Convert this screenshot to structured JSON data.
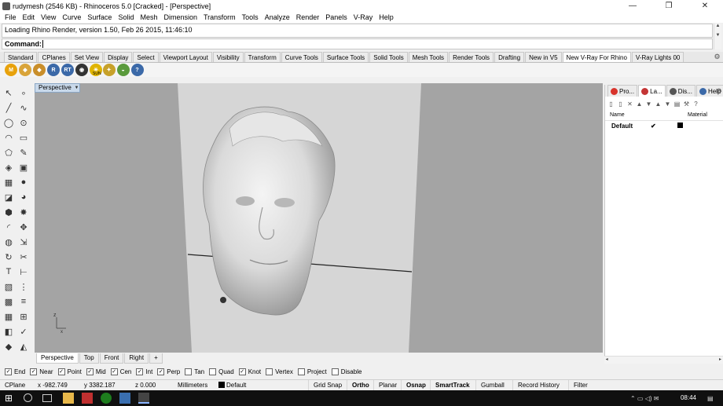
{
  "window": {
    "title": "rudymesh (2546 KB) - Rhinoceros 5.0 [Cracked] - [Perspective]"
  },
  "menu": [
    "File",
    "Edit",
    "View",
    "Curve",
    "Surface",
    "Solid",
    "Mesh",
    "Dimension",
    "Transform",
    "Tools",
    "Analyze",
    "Render",
    "Panels",
    "V-Ray",
    "Help"
  ],
  "command": {
    "history": "Loading Rhino Render, version 1.50, Feb 26 2015, 11:46:10",
    "prompt_label": "Command:",
    "value": ""
  },
  "toolbar_tabs": [
    {
      "label": "Standard",
      "active": false
    },
    {
      "label": "CPlanes",
      "active": false
    },
    {
      "label": "Set View",
      "active": false
    },
    {
      "label": "Display",
      "active": false
    },
    {
      "label": "Select",
      "active": false
    },
    {
      "label": "Viewport Layout",
      "active": false
    },
    {
      "label": "Visibility",
      "active": false
    },
    {
      "label": "Transform",
      "active": false
    },
    {
      "label": "Curve Tools",
      "active": false
    },
    {
      "label": "Surface Tools",
      "active": false
    },
    {
      "label": "Solid Tools",
      "active": false
    },
    {
      "label": "Mesh Tools",
      "active": false
    },
    {
      "label": "Render Tools",
      "active": false
    },
    {
      "label": "Drafting",
      "active": false
    },
    {
      "label": "New in V5",
      "active": false
    },
    {
      "label": "New V-Ray For Rhino",
      "active": true
    },
    {
      "label": "V-Ray Lights 00",
      "active": false
    }
  ],
  "toolbar_icons": [
    {
      "name": "vray-m-icon",
      "glyph": "M",
      "color": "#e8a20c"
    },
    {
      "name": "vray-material-icon",
      "glyph": "◆",
      "color": "#d9a43a"
    },
    {
      "name": "vray-options-icon",
      "glyph": "◆",
      "color": "#c98e2a"
    },
    {
      "name": "vray-r-icon",
      "glyph": "R",
      "color": "#3b69a8"
    },
    {
      "name": "vray-rt-icon",
      "glyph": "RT",
      "color": "#3b69a8"
    },
    {
      "name": "vray-camera-icon",
      "glyph": "◉",
      "color": "#333333"
    },
    {
      "name": "vray-sun-icon",
      "glyph": "☀",
      "color": "#e0b400"
    },
    {
      "name": "vray-light-icon",
      "glyph": "✦",
      "color": "#c7a12a"
    },
    {
      "name": "vray-dome-icon",
      "glyph": "◒",
      "color": "#5a9a3c"
    },
    {
      "name": "vray-help-icon",
      "glyph": "?",
      "color": "#3b69a8"
    }
  ],
  "sun_label": "SUN",
  "viewport": {
    "name": "Perspective",
    "tabs": [
      {
        "label": "Perspective",
        "active": true
      },
      {
        "label": "Top",
        "active": false
      },
      {
        "label": "Front",
        "active": false
      },
      {
        "label": "Right",
        "active": false
      },
      {
        "label": "+",
        "active": false
      }
    ],
    "axis_z": "z",
    "axis_x": "x"
  },
  "right_panel": {
    "tabs": [
      {
        "label": "Pro...",
        "icon": "properties-icon",
        "color": "#d8342c",
        "active": false
      },
      {
        "label": "La...",
        "icon": "layers-icon",
        "color": "#c43535",
        "active": true
      },
      {
        "label": "Dis...",
        "icon": "display-icon",
        "color": "#555555",
        "active": false
      },
      {
        "label": "Help",
        "icon": "help-icon",
        "color": "#3b69a8",
        "active": false
      }
    ],
    "columns": {
      "name": "Name",
      "material": "Material"
    },
    "layer": {
      "name": "Default",
      "check": "✔"
    }
  },
  "osnaps": [
    {
      "label": "End",
      "checked": true
    },
    {
      "label": "Near",
      "checked": true
    },
    {
      "label": "Point",
      "checked": true
    },
    {
      "label": "Mid",
      "checked": true
    },
    {
      "label": "Cen",
      "checked": true
    },
    {
      "label": "Int",
      "checked": true
    },
    {
      "label": "Perp",
      "checked": true
    },
    {
      "label": "Tan",
      "checked": false
    },
    {
      "label": "Quad",
      "checked": false
    },
    {
      "label": "Knot",
      "checked": true
    },
    {
      "label": "Vertex",
      "checked": false
    },
    {
      "label": "Project",
      "checked": false
    },
    {
      "label": "Disable",
      "checked": false
    }
  ],
  "status": {
    "cplane": "CPlane",
    "x": "x -982.749",
    "y": "y 3382.187",
    "z": "z 0.000",
    "units": "Millimeters",
    "layer": "Default",
    "panes": [
      {
        "label": "Grid Snap",
        "bold": false
      },
      {
        "label": "Ortho",
        "bold": true
      },
      {
        "label": "Planar",
        "bold": false
      },
      {
        "label": "Osnap",
        "bold": true
      },
      {
        "label": "SmartTrack",
        "bold": true
      },
      {
        "label": "Gumball",
        "bold": false
      },
      {
        "label": "Record History",
        "bold": false
      },
      {
        "label": "Filter",
        "bold": false
      }
    ]
  },
  "taskbar": {
    "time": "08:44"
  }
}
